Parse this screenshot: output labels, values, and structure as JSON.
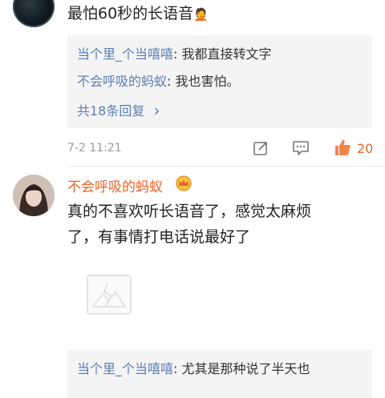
{
  "comment1": {
    "text": "最怕60秒的长语音",
    "emoji": "🤦",
    "replies": [
      {
        "user": "当个里_个当嘻嘻",
        "text": ": 我都直接转文字"
      },
      {
        "user": "不会呼吸的蚂蚁",
        "text": ": 我也害怕。"
      }
    ],
    "more_replies": "共18条回复",
    "more_arrow": "›",
    "timestamp": "7-2 11:21",
    "likes": "20",
    "icons": [
      "share-icon",
      "comment-icon",
      "like-icon"
    ]
  },
  "comment2": {
    "user": "不会呼吸的蚂蚁",
    "badge": "crown-icon",
    "text_line1": "真的不喜欢听长语音了，感觉太麻烦",
    "text_line2": "了，有事情打电话说最好了",
    "replies": [
      {
        "user": "当个里_个当嘻嘻",
        "text": ": 尤其是那种说了半天也"
      }
    ]
  },
  "colors": {
    "link_blue": "#5a7fb5",
    "name_orange": "#e8632b",
    "like_orange": "#e06a2b"
  }
}
